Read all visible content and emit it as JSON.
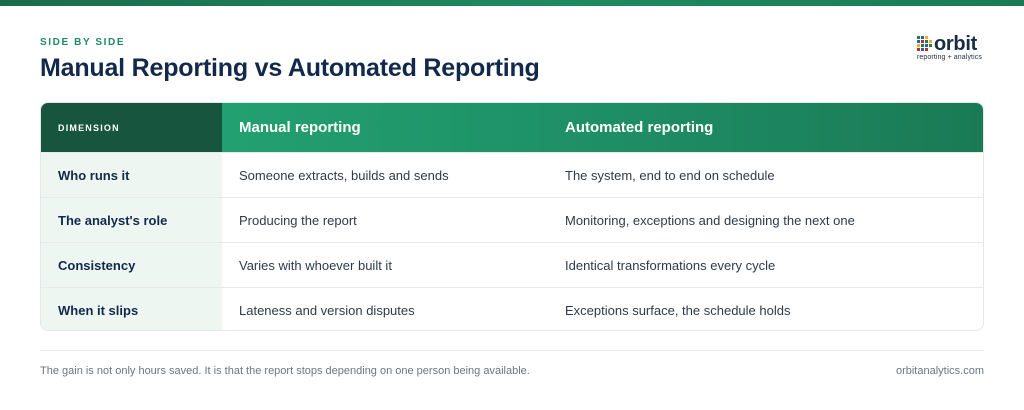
{
  "header": {
    "eyebrow": "SIDE BY SIDE",
    "title": "Manual Reporting vs Automated Reporting"
  },
  "logo": {
    "wordmark": "orbit",
    "tagline": "reporting + analytics",
    "colors": [
      "#2e7d32",
      "#1565c0",
      "#f9a825",
      "#c62828"
    ]
  },
  "table": {
    "columns": [
      "DIMENSION",
      "Manual reporting",
      "Automated reporting"
    ],
    "rows": [
      {
        "dimension": "Who runs it",
        "manual": "Someone extracts, builds and sends",
        "automated": "The system, end to end on schedule"
      },
      {
        "dimension": "The analyst's role",
        "manual": "Producing the report",
        "automated": "Monitoring, exceptions and designing the next one"
      },
      {
        "dimension": "Consistency",
        "manual": "Varies with whoever built it",
        "automated": "Identical transformations every cycle"
      },
      {
        "dimension": "When it slips",
        "manual": "Lateness and version disputes",
        "automated": "Exceptions surface, the schedule holds"
      }
    ]
  },
  "footer": {
    "note": "The gain is not only hours saved. It is that the report stops depending on one person being available.",
    "site": "orbitanalytics.com"
  },
  "colors": {
    "accent": "#1f8a64",
    "title": "#13294b",
    "header_dark": "#17553f",
    "header_green": "#23a071"
  }
}
